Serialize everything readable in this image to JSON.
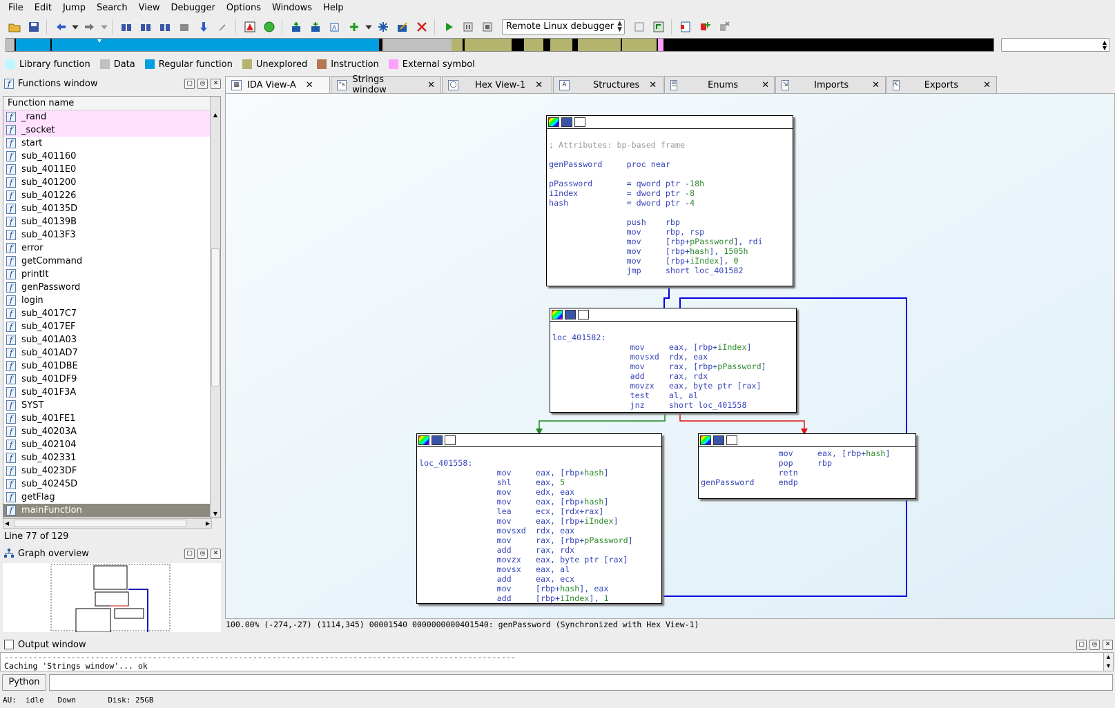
{
  "menu": [
    "File",
    "Edit",
    "Jump",
    "Search",
    "View",
    "Debugger",
    "Options",
    "Windows",
    "Help"
  ],
  "toolbar": {
    "debugger_select": "Remote Linux debugger"
  },
  "legend": [
    {
      "label": "Library function",
      "color": "#bff6ff"
    },
    {
      "label": "Data",
      "color": "#c0c0c0"
    },
    {
      "label": "Regular function",
      "color": "#00a0e0"
    },
    {
      "label": "Unexplored",
      "color": "#b4b46e"
    },
    {
      "label": "Instruction",
      "color": "#b47850"
    },
    {
      "label": "External symbol",
      "color": "#ffa0ff"
    }
  ],
  "functions_panel": {
    "title": "Functions window",
    "column": "Function name",
    "items": [
      "_rand",
      "_socket",
      "start",
      "sub_401160",
      "sub_4011E0",
      "sub_401200",
      "sub_401226",
      "sub_40135D",
      "sub_40139B",
      "sub_4013F3",
      "error",
      "getCommand",
      "printIt",
      "genPassword",
      "login",
      "sub_4017C7",
      "sub_4017EF",
      "sub_401A03",
      "sub_401AD7",
      "sub_401DBE",
      "sub_401DF9",
      "sub_401F3A",
      "SYST",
      "sub_401FE1",
      "sub_40203A",
      "sub_402104",
      "sub_402331",
      "sub_4023DF",
      "sub_40245D",
      "getFlag",
      "mainFunction"
    ],
    "line_info": "Line 77 of 129"
  },
  "graph_overview": {
    "title": "Graph overview"
  },
  "tabs": [
    "IDA View-A",
    "Strings window",
    "Hex View-1",
    "Structures",
    "Enums",
    "Imports",
    "Exports"
  ],
  "nodes": {
    "n1": {
      "lines": [
        "",
        "; Attributes: bp-based frame",
        "",
        "genPassword     proc near",
        "",
        "pPassword       = qword ptr -18h",
        "iIndex          = dword ptr -8",
        "hash            = dword ptr -4",
        "",
        "                push    rbp",
        "                mov     rbp, rsp",
        "                mov     [rbp+pPassword], rdi",
        "                mov     [rbp+hash], 1505h",
        "                mov     [rbp+iIndex], 0",
        "                jmp     short loc_401582"
      ]
    },
    "n2": {
      "lines": [
        "",
        "loc_401582:",
        "                mov     eax, [rbp+iIndex]",
        "                movsxd  rdx, eax",
        "                mov     rax, [rbp+pPassword]",
        "                add     rax, rdx",
        "                movzx   eax, byte ptr [rax]",
        "                test    al, al",
        "                jnz     short loc_401558"
      ]
    },
    "n3": {
      "lines": [
        "",
        "loc_401558:",
        "                mov     eax, [rbp+hash]",
        "                shl     eax, 5",
        "                mov     edx, eax",
        "                mov     eax, [rbp+hash]",
        "                lea     ecx, [rdx+rax]",
        "                mov     eax, [rbp+iIndex]",
        "                movsxd  rdx, eax",
        "                mov     rax, [rbp+pPassword]",
        "                add     rax, rdx",
        "                movzx   eax, byte ptr [rax]",
        "                movsx   eax, al",
        "                add     eax, ecx",
        "                mov     [rbp+hash], eax",
        "                add     [rbp+iIndex], 1"
      ]
    },
    "n4": {
      "lines": [
        "                mov     eax, [rbp+hash]",
        "                pop     rbp",
        "                retn",
        "genPassword     endp"
      ]
    }
  },
  "graph_status": "100.00% (-274,-27) (1114,345) 00001540 0000000000401540: genPassword (Synchronized with Hex View-1)",
  "output": {
    "title": "Output window",
    "lines": [
      "-----------------------------------------------------------------------------------------------------------",
      "Caching 'Strings window'... ok"
    ],
    "python_button": "Python"
  },
  "status": "AU:  idle   Down       Disk: 25GB"
}
